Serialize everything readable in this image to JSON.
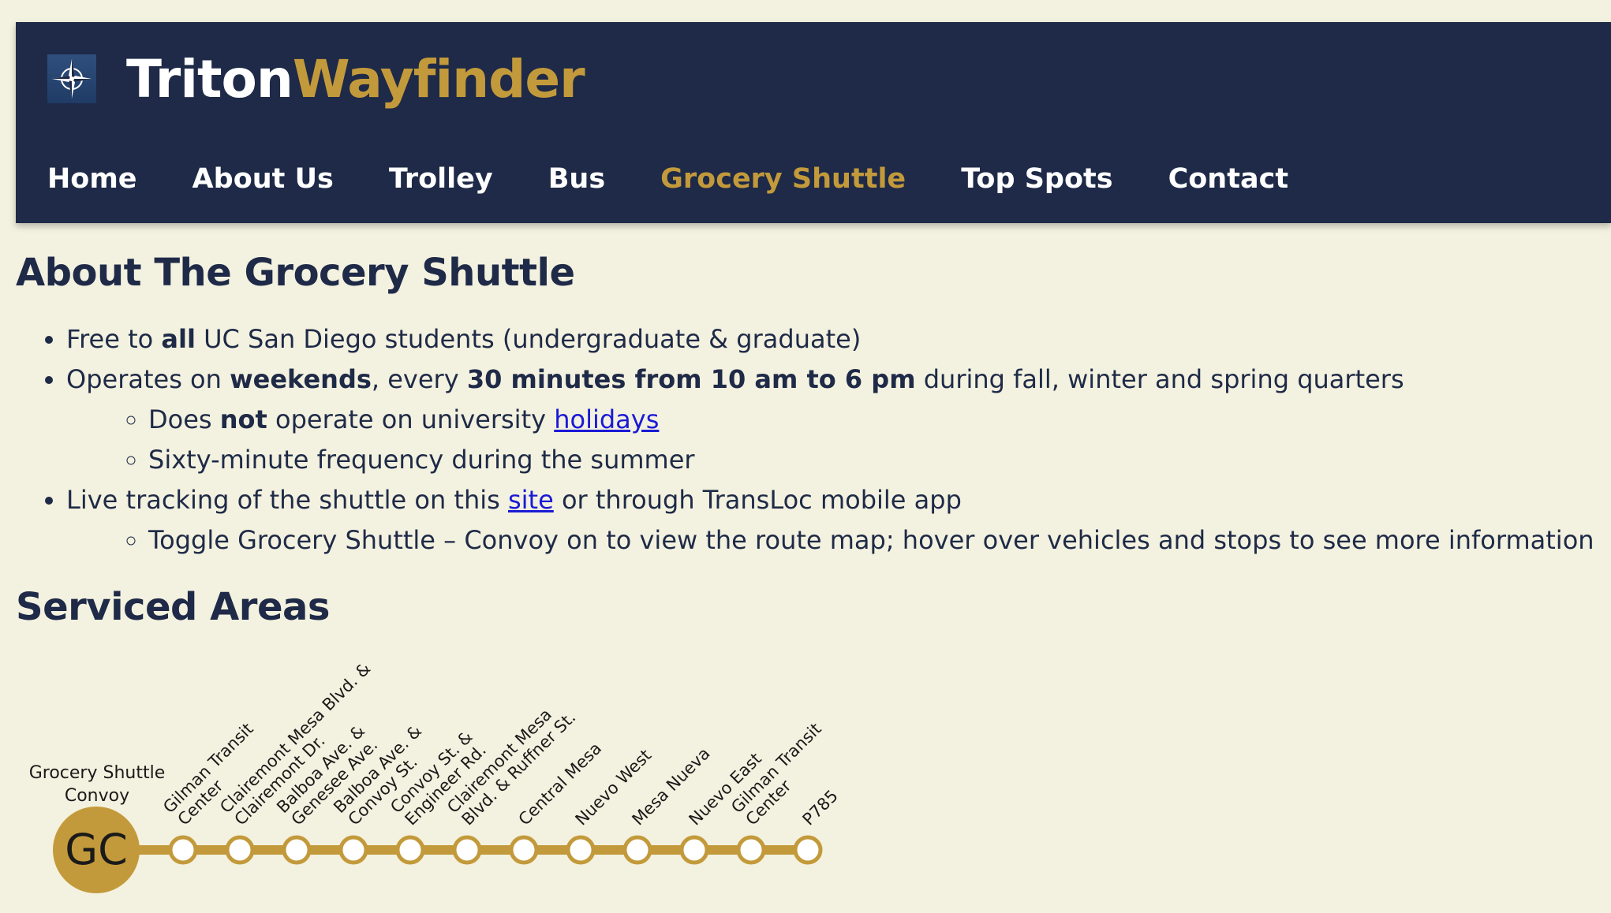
{
  "brand": {
    "part1": "Triton",
    "part2": "Wayfinder",
    "icon": "compass-icon"
  },
  "nav": [
    {
      "label": "Home",
      "active": false
    },
    {
      "label": "About Us",
      "active": false
    },
    {
      "label": "Trolley",
      "active": false
    },
    {
      "label": "Bus",
      "active": false
    },
    {
      "label": "Grocery Shuttle",
      "active": true
    },
    {
      "label": "Top Spots",
      "active": false
    },
    {
      "label": "Contact",
      "active": false
    }
  ],
  "about": {
    "heading": "About The Grocery Shuttle",
    "b1": {
      "t1": "Free to ",
      "strong": "all",
      "t2": " UC San Diego students (undergraduate & graduate)"
    },
    "b2": {
      "t1": "Operates on ",
      "s1": "weekends",
      "t2": ", every ",
      "s2": "30 minutes from 10 am to 6 pm",
      "t3": " during fall, winter and spring quarters",
      "sub1": {
        "t1": "Does ",
        "strong": "not",
        "t2": " operate on university ",
        "link": "holidays"
      },
      "sub2": "Sixty-minute frequency during the summer"
    },
    "b3": {
      "t1": "Live tracking of the shuttle on this ",
      "link": "site",
      "t2": " or through TransLoc mobile app",
      "sub1": "Toggle Grocery Shuttle – Convoy on to view the route map; hover over vehicles and stops to see more information"
    }
  },
  "areas": {
    "heading": "Serviced Areas",
    "route_name": [
      "Grocery Shuttle",
      "Convoy"
    ],
    "badge": "GC",
    "stops": [
      [
        "Gilman Transit",
        "Center"
      ],
      [
        "Clairemont Mesa Blvd. &",
        "Clairemont Dr."
      ],
      [
        "Balboa Ave. &",
        "Genesee Ave."
      ],
      [
        "Balboa Ave. &",
        "Convoy St."
      ],
      [
        "Convoy St. &",
        "Engineer Rd."
      ],
      [
        "Clairemont Mesa",
        "Blvd. & Ruffner St."
      ],
      [
        "Central Mesa"
      ],
      [
        "Nuevo West"
      ],
      [
        "Mesa Nueva"
      ],
      [
        "Nuevo East"
      ],
      [
        "Gilman Transit",
        "Center"
      ],
      [
        "P785"
      ]
    ],
    "colors": {
      "route": "#c39a3b",
      "stop_fill": "#ffffff",
      "text": "#1a1a1a"
    }
  }
}
